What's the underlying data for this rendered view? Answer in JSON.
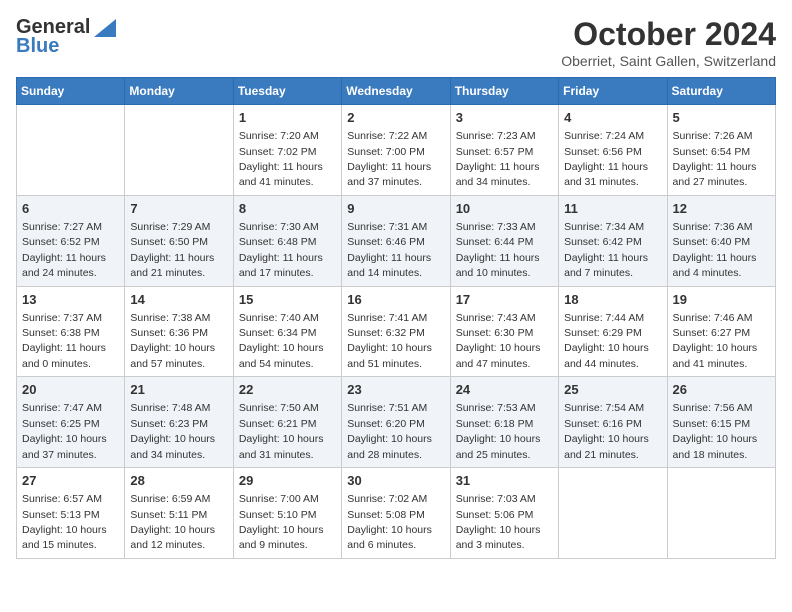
{
  "logo": {
    "general": "General",
    "blue": "Blue"
  },
  "title": "October 2024",
  "location": "Oberriet, Saint Gallen, Switzerland",
  "headers": [
    "Sunday",
    "Monday",
    "Tuesday",
    "Wednesday",
    "Thursday",
    "Friday",
    "Saturday"
  ],
  "weeks": [
    [
      {
        "day": "",
        "sunrise": "",
        "sunset": "",
        "daylight": ""
      },
      {
        "day": "",
        "sunrise": "",
        "sunset": "",
        "daylight": ""
      },
      {
        "day": "1",
        "sunrise": "Sunrise: 7:20 AM",
        "sunset": "Sunset: 7:02 PM",
        "daylight": "Daylight: 11 hours and 41 minutes."
      },
      {
        "day": "2",
        "sunrise": "Sunrise: 7:22 AM",
        "sunset": "Sunset: 7:00 PM",
        "daylight": "Daylight: 11 hours and 37 minutes."
      },
      {
        "day": "3",
        "sunrise": "Sunrise: 7:23 AM",
        "sunset": "Sunset: 6:57 PM",
        "daylight": "Daylight: 11 hours and 34 minutes."
      },
      {
        "day": "4",
        "sunrise": "Sunrise: 7:24 AM",
        "sunset": "Sunset: 6:56 PM",
        "daylight": "Daylight: 11 hours and 31 minutes."
      },
      {
        "day": "5",
        "sunrise": "Sunrise: 7:26 AM",
        "sunset": "Sunset: 6:54 PM",
        "daylight": "Daylight: 11 hours and 27 minutes."
      }
    ],
    [
      {
        "day": "6",
        "sunrise": "Sunrise: 7:27 AM",
        "sunset": "Sunset: 6:52 PM",
        "daylight": "Daylight: 11 hours and 24 minutes."
      },
      {
        "day": "7",
        "sunrise": "Sunrise: 7:29 AM",
        "sunset": "Sunset: 6:50 PM",
        "daylight": "Daylight: 11 hours and 21 minutes."
      },
      {
        "day": "8",
        "sunrise": "Sunrise: 7:30 AM",
        "sunset": "Sunset: 6:48 PM",
        "daylight": "Daylight: 11 hours and 17 minutes."
      },
      {
        "day": "9",
        "sunrise": "Sunrise: 7:31 AM",
        "sunset": "Sunset: 6:46 PM",
        "daylight": "Daylight: 11 hours and 14 minutes."
      },
      {
        "day": "10",
        "sunrise": "Sunrise: 7:33 AM",
        "sunset": "Sunset: 6:44 PM",
        "daylight": "Daylight: 11 hours and 10 minutes."
      },
      {
        "day": "11",
        "sunrise": "Sunrise: 7:34 AM",
        "sunset": "Sunset: 6:42 PM",
        "daylight": "Daylight: 11 hours and 7 minutes."
      },
      {
        "day": "12",
        "sunrise": "Sunrise: 7:36 AM",
        "sunset": "Sunset: 6:40 PM",
        "daylight": "Daylight: 11 hours and 4 minutes."
      }
    ],
    [
      {
        "day": "13",
        "sunrise": "Sunrise: 7:37 AM",
        "sunset": "Sunset: 6:38 PM",
        "daylight": "Daylight: 11 hours and 0 minutes."
      },
      {
        "day": "14",
        "sunrise": "Sunrise: 7:38 AM",
        "sunset": "Sunset: 6:36 PM",
        "daylight": "Daylight: 10 hours and 57 minutes."
      },
      {
        "day": "15",
        "sunrise": "Sunrise: 7:40 AM",
        "sunset": "Sunset: 6:34 PM",
        "daylight": "Daylight: 10 hours and 54 minutes."
      },
      {
        "day": "16",
        "sunrise": "Sunrise: 7:41 AM",
        "sunset": "Sunset: 6:32 PM",
        "daylight": "Daylight: 10 hours and 51 minutes."
      },
      {
        "day": "17",
        "sunrise": "Sunrise: 7:43 AM",
        "sunset": "Sunset: 6:30 PM",
        "daylight": "Daylight: 10 hours and 47 minutes."
      },
      {
        "day": "18",
        "sunrise": "Sunrise: 7:44 AM",
        "sunset": "Sunset: 6:29 PM",
        "daylight": "Daylight: 10 hours and 44 minutes."
      },
      {
        "day": "19",
        "sunrise": "Sunrise: 7:46 AM",
        "sunset": "Sunset: 6:27 PM",
        "daylight": "Daylight: 10 hours and 41 minutes."
      }
    ],
    [
      {
        "day": "20",
        "sunrise": "Sunrise: 7:47 AM",
        "sunset": "Sunset: 6:25 PM",
        "daylight": "Daylight: 10 hours and 37 minutes."
      },
      {
        "day": "21",
        "sunrise": "Sunrise: 7:48 AM",
        "sunset": "Sunset: 6:23 PM",
        "daylight": "Daylight: 10 hours and 34 minutes."
      },
      {
        "day": "22",
        "sunrise": "Sunrise: 7:50 AM",
        "sunset": "Sunset: 6:21 PM",
        "daylight": "Daylight: 10 hours and 31 minutes."
      },
      {
        "day": "23",
        "sunrise": "Sunrise: 7:51 AM",
        "sunset": "Sunset: 6:20 PM",
        "daylight": "Daylight: 10 hours and 28 minutes."
      },
      {
        "day": "24",
        "sunrise": "Sunrise: 7:53 AM",
        "sunset": "Sunset: 6:18 PM",
        "daylight": "Daylight: 10 hours and 25 minutes."
      },
      {
        "day": "25",
        "sunrise": "Sunrise: 7:54 AM",
        "sunset": "Sunset: 6:16 PM",
        "daylight": "Daylight: 10 hours and 21 minutes."
      },
      {
        "day": "26",
        "sunrise": "Sunrise: 7:56 AM",
        "sunset": "Sunset: 6:15 PM",
        "daylight": "Daylight: 10 hours and 18 minutes."
      }
    ],
    [
      {
        "day": "27",
        "sunrise": "Sunrise: 6:57 AM",
        "sunset": "Sunset: 5:13 PM",
        "daylight": "Daylight: 10 hours and 15 minutes."
      },
      {
        "day": "28",
        "sunrise": "Sunrise: 6:59 AM",
        "sunset": "Sunset: 5:11 PM",
        "daylight": "Daylight: 10 hours and 12 minutes."
      },
      {
        "day": "29",
        "sunrise": "Sunrise: 7:00 AM",
        "sunset": "Sunset: 5:10 PM",
        "daylight": "Daylight: 10 hours and 9 minutes."
      },
      {
        "day": "30",
        "sunrise": "Sunrise: 7:02 AM",
        "sunset": "Sunset: 5:08 PM",
        "daylight": "Daylight: 10 hours and 6 minutes."
      },
      {
        "day": "31",
        "sunrise": "Sunrise: 7:03 AM",
        "sunset": "Sunset: 5:06 PM",
        "daylight": "Daylight: 10 hours and 3 minutes."
      },
      {
        "day": "",
        "sunrise": "",
        "sunset": "",
        "daylight": ""
      },
      {
        "day": "",
        "sunrise": "",
        "sunset": "",
        "daylight": ""
      }
    ]
  ]
}
